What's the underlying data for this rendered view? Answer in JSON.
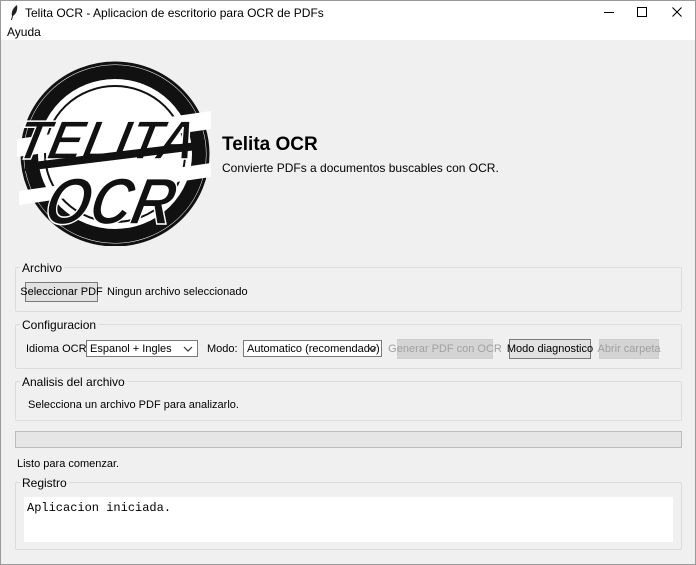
{
  "window": {
    "title": "Telita OCR - Aplicacion de escritorio para OCR de PDFs"
  },
  "menu": {
    "items": [
      "Ayuda"
    ]
  },
  "header": {
    "logo_line1": "TELITA",
    "logo_line2": "OCR",
    "title": "Telita OCR",
    "subtitle": "Convierte PDFs a documentos buscables con OCR."
  },
  "archivo": {
    "group_label": "Archivo",
    "select_button": "Seleccionar PDF",
    "file_status": "Ningun archivo seleccionado"
  },
  "config": {
    "group_label": "Configuracion",
    "language_label": "Idioma OCR:",
    "language_value": "Espanol + Ingles",
    "mode_label": "Modo:",
    "mode_value": "Automatico (recomendado)",
    "generate_button": "Generar PDF con OCR",
    "diagnostic_button": "Modo diagnostico",
    "open_folder_button": "Abrir carpeta"
  },
  "analysis": {
    "group_label": "Analisis del archivo",
    "message": "Selecciona un archivo PDF para analizarlo."
  },
  "progress": {
    "value": 0
  },
  "status": {
    "text": "Listo para comenzar."
  },
  "log": {
    "group_label": "Registro",
    "content": "Aplicacion iniciada."
  },
  "colors": {
    "window_bg": "#f0f0f0",
    "button_bg": "#e1e1e1",
    "progress_fill": "#06b025"
  }
}
